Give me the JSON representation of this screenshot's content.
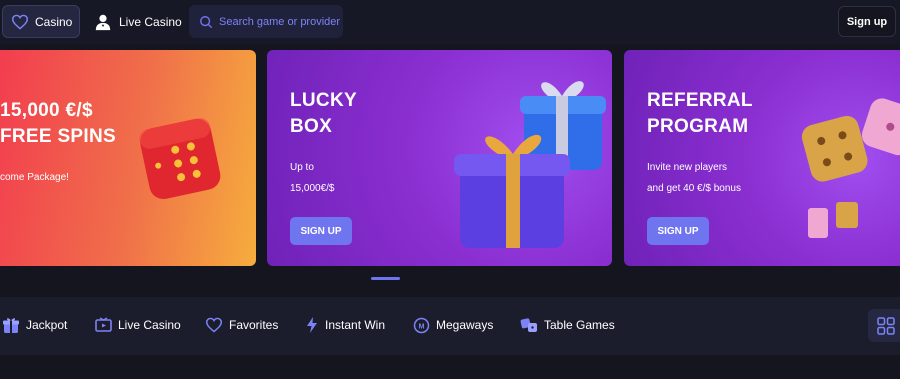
{
  "topbar": {
    "casino_label": "Casino",
    "live_casino_label": "Live Casino",
    "search_placeholder": "Search game or provider",
    "signup_label": "Sign up"
  },
  "banners": [
    {
      "title_line1": "15,000 €/$",
      "title_line2": "FREE SPINS",
      "subtitle": "come Package!"
    },
    {
      "title_line1": "LUCKY",
      "title_line2": "BOX",
      "text_line1": "Up to",
      "text_line2": "15,000€/$",
      "button_label": "SIGN UP"
    },
    {
      "title_line1": "REFERRAL",
      "title_line2": "PROGRAM",
      "text_line1": "Invite new players",
      "text_line2": "and get 40 €/$ bonus",
      "button_label": "SIGN UP"
    }
  ],
  "categories": [
    {
      "label": "Jackpot",
      "icon": "gift-icon"
    },
    {
      "label": "Live Casino",
      "icon": "tv-icon"
    },
    {
      "label": "Favorites",
      "icon": "heart-icon"
    },
    {
      "label": "Instant Win",
      "icon": "lightning-icon"
    },
    {
      "label": "Megaways",
      "icon": "megaways-icon"
    },
    {
      "label": "Table Games",
      "icon": "dice-icon"
    }
  ],
  "colors": {
    "background": "#14151f",
    "accent": "#6f74ef",
    "banner_purple": "#8a2ed0",
    "banner_orange": "#f0704a"
  }
}
